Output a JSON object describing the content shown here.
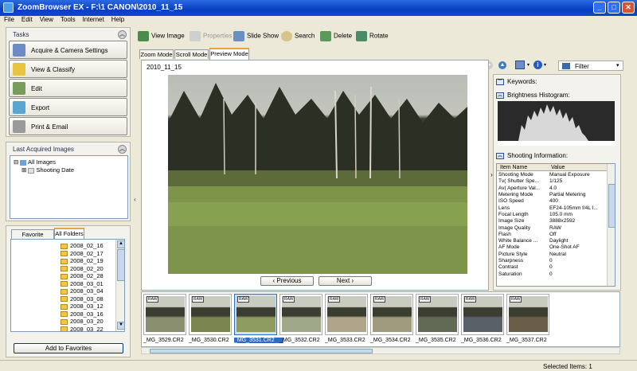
{
  "window": {
    "title": "ZoomBrowser EX  -  F:\\1 CANON\\2010_11_15",
    "min": "_",
    "max": "□",
    "close": "✕"
  },
  "menu": [
    "File",
    "Edit",
    "View",
    "Tools",
    "Internet",
    "Help"
  ],
  "tasks": {
    "header": "Tasks",
    "buttons": [
      "Acquire & Camera Settings",
      "View & Classify",
      "Edit",
      "Export",
      "Print & Email"
    ]
  },
  "last_acquired": {
    "header": "Last Acquired Images",
    "tree": [
      "All Images",
      "Shooting Date"
    ]
  },
  "folders": {
    "tabs": [
      "Favorite Folders",
      "All Folders"
    ],
    "items": [
      "2008_02_16",
      "2008_02_17",
      "2008_02_19",
      "2008_02_20",
      "2008_02_28",
      "2008_03_01",
      "2008_03_04",
      "2008_03_08",
      "2008_03_12",
      "2008_03_16",
      "2008_03_20",
      "2008_03_22"
    ],
    "add_button": "Add to Favorites"
  },
  "toolbar": [
    "View Image",
    "Properties",
    "Slide Show",
    "Search",
    "Delete",
    "Rotate"
  ],
  "view_tabs": [
    "Zoom Mode",
    "Scroll Mode",
    "Preview Mode"
  ],
  "filter_label": "Filter",
  "current_folder": "2010_11_15",
  "nav": {
    "prev": "‹ Previous",
    "next": "Next ›"
  },
  "right_panel": {
    "keywords": "Keywords:",
    "histogram": "Brightness Histogram:",
    "shooting": "Shooting Information:",
    "table_headers": [
      "Item Name",
      "Value"
    ],
    "rows": [
      [
        "Shooting Mode",
        "Manual Exposure"
      ],
      [
        "Tv( Shutter Spe...",
        "1/125"
      ],
      [
        "Av( Aperture Val...",
        "4.0"
      ],
      [
        "Metering Mode",
        "Partial Metering"
      ],
      [
        "ISO Speed",
        "400"
      ],
      [
        "Lens",
        "EF24-105mm f/4L I..."
      ],
      [
        "Focal Length",
        "105.0 mm"
      ],
      [
        "Image Size",
        "3888x2592"
      ],
      [
        "Image Quality",
        "RAW"
      ],
      [
        "Flash",
        "Off"
      ],
      [
        "White Balance ...",
        "Daylight"
      ],
      [
        "AF Mode",
        "One-Shot AF"
      ],
      [
        "Picture Style",
        "Neutral"
      ],
      [
        "Sharpness",
        "0"
      ],
      [
        "Contrast",
        "0"
      ],
      [
        "Saturation",
        "0"
      ]
    ]
  },
  "thumbnails": [
    {
      "name": "_MG_3529.CR2",
      "badge": "RAW"
    },
    {
      "name": "_MG_3530.CR2",
      "badge": "RAW"
    },
    {
      "name": "_MG_3531.CR2",
      "badge": "RAW"
    },
    {
      "name": "_MG_3532.CR2",
      "badge": "RAW"
    },
    {
      "name": "_MG_3533.CR2",
      "badge": "RAW"
    },
    {
      "name": "_MG_3534.CR2",
      "badge": "RAW"
    },
    {
      "name": "_MG_3535.CR2",
      "badge": "RAW"
    },
    {
      "name": "_MG_3536.CR2",
      "badge": "RAW"
    },
    {
      "name": "_MG_3537.CR2",
      "badge": "RAW"
    }
  ],
  "status": "Selected Items: 1"
}
